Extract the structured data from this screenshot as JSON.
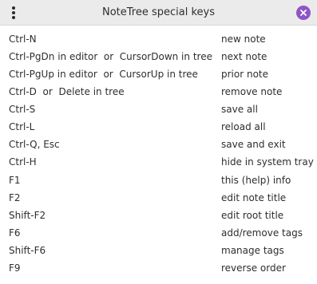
{
  "window": {
    "title": "NoteTree special keys",
    "menu_icon": "kebab-menu-icon",
    "close_icon": "close-icon",
    "accent_color": "#8e55c7"
  },
  "shortcuts": [
    {
      "keys": "Ctrl-N",
      "action": "new note"
    },
    {
      "keys": "Ctrl-PgDn in editor  or  CursorDown in tree",
      "action": "next note"
    },
    {
      "keys": "Ctrl-PgUp in editor  or  CursorUp in tree",
      "action": "prior note"
    },
    {
      "keys": "Ctrl-D  or  Delete in tree",
      "action": "remove note"
    },
    {
      "keys": "Ctrl-S",
      "action": "save all"
    },
    {
      "keys": "Ctrl-L",
      "action": "reload all"
    },
    {
      "keys": "Ctrl-Q, Esc",
      "action": "save and exit"
    },
    {
      "keys": "Ctrl-H",
      "action": "hide in system tray"
    },
    {
      "keys": "F1",
      "action": "this (help) info"
    },
    {
      "keys": "F2",
      "action": "edit note title"
    },
    {
      "keys": "Shift-F2",
      "action": "edit root title"
    },
    {
      "keys": "F6",
      "action": "add/remove tags"
    },
    {
      "keys": "Shift-F6",
      "action": "manage tags"
    },
    {
      "keys": "F9",
      "action": "reverse order"
    }
  ]
}
